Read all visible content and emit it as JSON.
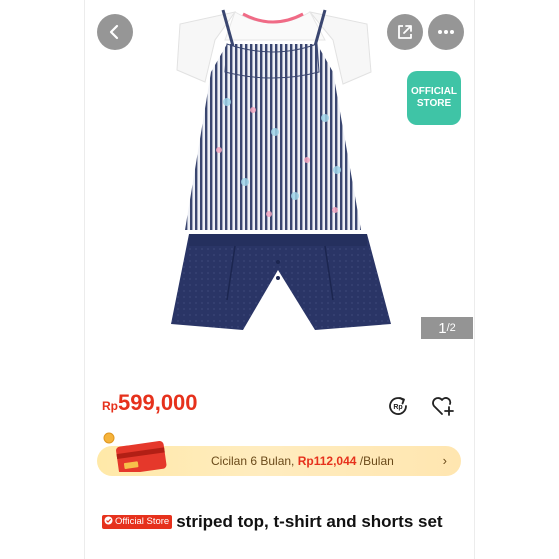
{
  "hero": {
    "official_badge": "OFFICIAL\nSTORE",
    "image_counter_current": "1",
    "image_counter_total": "/2"
  },
  "price": {
    "currency": "Rp",
    "amount": "599,000"
  },
  "installment": {
    "prefix": "Cicilan 6 Bulan, ",
    "amount": "Rp112,044",
    "suffix": " /Bulan",
    "chevron": "›"
  },
  "product": {
    "store_tag": "Official Store",
    "title": "striped top, t-shirt and shorts set"
  },
  "colors": {
    "price": "#e6311c",
    "official_badge": "#3fc4a6",
    "banner": "#ffe9a8"
  },
  "icons": [
    "back-arrow-icon",
    "share-icon",
    "more-icon",
    "price-check-icon",
    "wishlist-add-icon",
    "credit-card-icon",
    "check-circle-icon"
  ]
}
